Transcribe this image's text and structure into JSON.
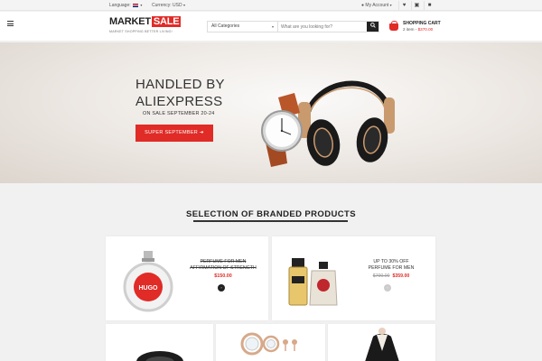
{
  "topbar": {
    "language_label": "Language:",
    "currency_label": "Currency: USD",
    "account_label": "My Account"
  },
  "header": {
    "logo_main": "MARKET",
    "logo_accent": "SALE",
    "tagline": "MARKET SHOPPING BETTER LIVING!",
    "search": {
      "category": "All Categories",
      "placeholder": "What are you looking for?"
    },
    "cart": {
      "title": "SHOPPING CART",
      "count_text": "2 item -",
      "amount": "$370.00"
    }
  },
  "hero": {
    "title_line1": "HANDLED BY",
    "title_line2": "ALIEXPRESS",
    "subtitle": "ON SALE SEPTEMBER 20-24",
    "cta_label": "SUPER SEPTEMBER"
  },
  "section": {
    "title": "SELECTION OF BRANDED PRODUCTS"
  },
  "products": [
    {
      "line1": "PERFUME FOR MEN",
      "line2": "AFFIRMATION OF STRENGTH",
      "price": "$150.00",
      "brand_text": "HUGO"
    },
    {
      "line1": "UP TO 30% OFF",
      "line2": "PERFUME FOR MEN",
      "old_price": "$700.00",
      "price": "$359.00"
    }
  ],
  "colors": {
    "accent": "#e02b27",
    "dark": "#222222"
  }
}
